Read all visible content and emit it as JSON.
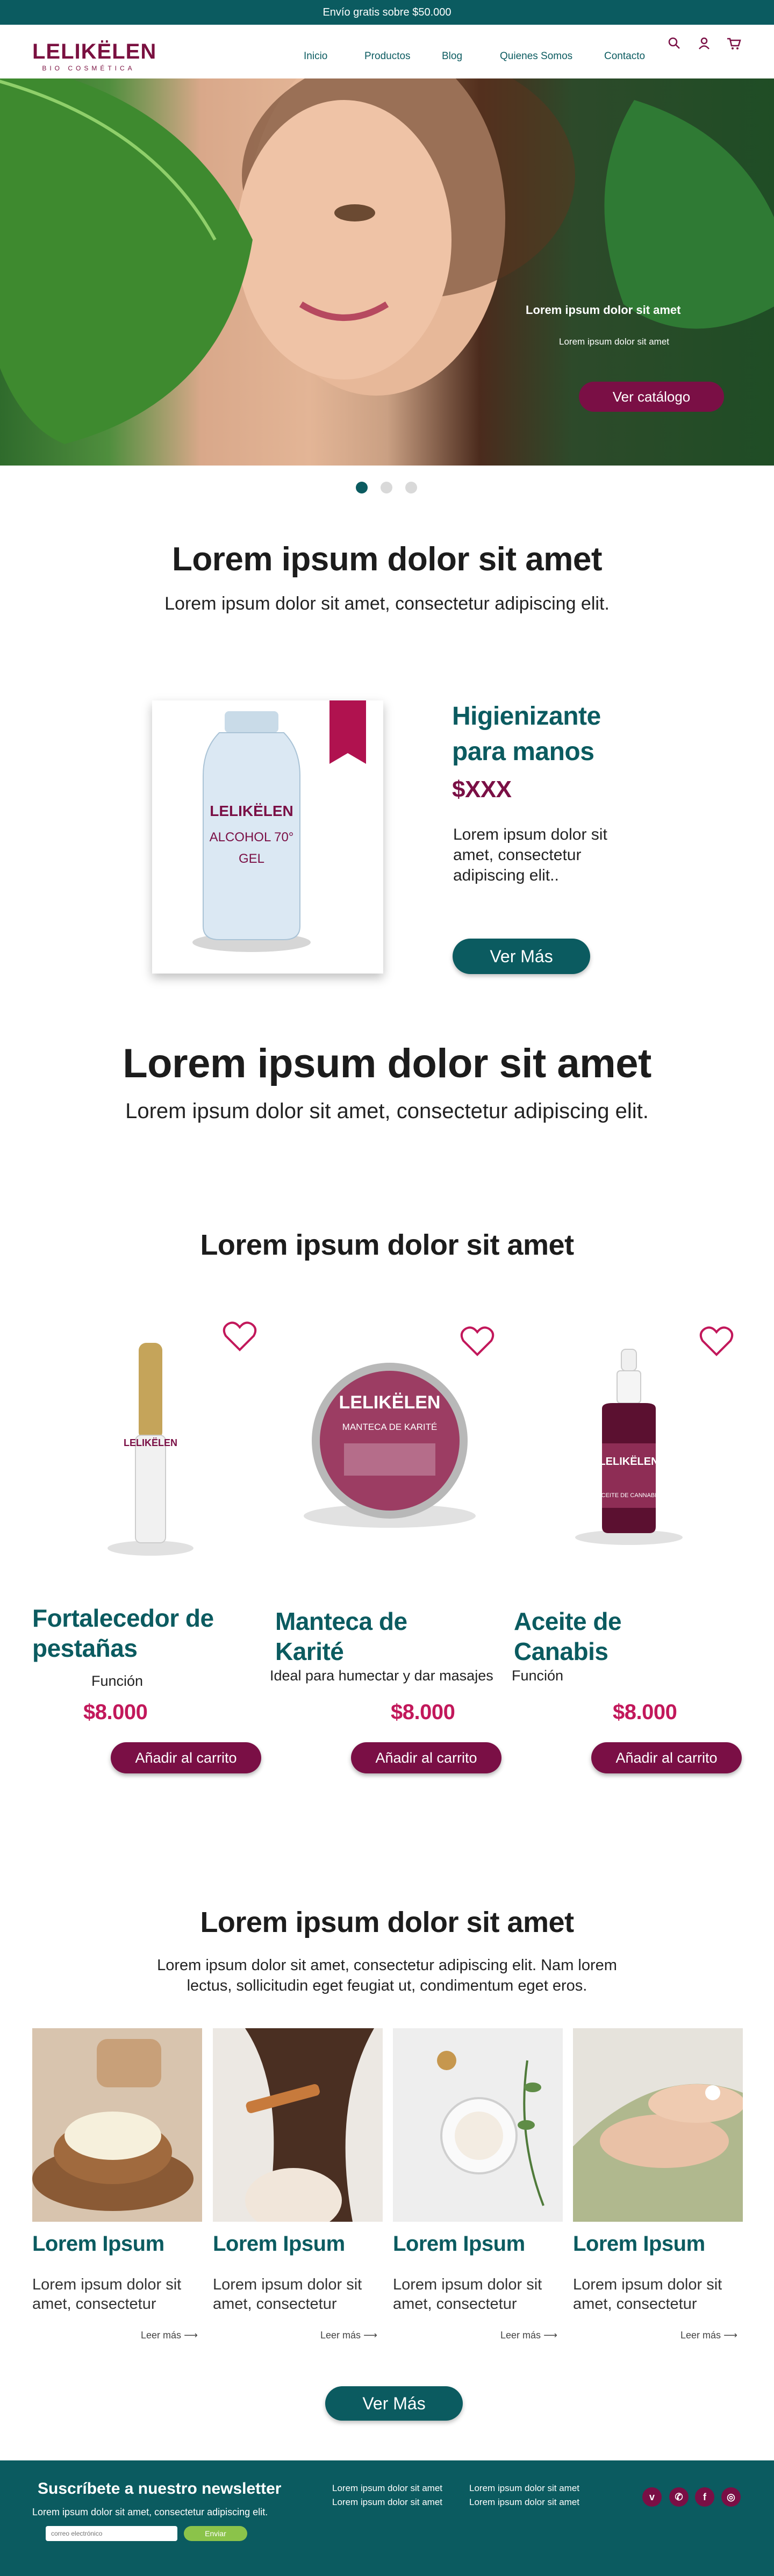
{
  "topbar": {
    "shipping": "Envío gratis sobre $50.000"
  },
  "header": {
    "logo_word": "LELIKËLEN",
    "logo_sub": "BIO COSMÉTICA",
    "nav": [
      "Inicio",
      "Productos",
      "Blog",
      "Quienes Somos",
      "Contacto"
    ],
    "icons": [
      "search-icon",
      "user-icon",
      "cart-icon"
    ]
  },
  "hero": {
    "title": "Lorem ipsum dolor sit amet",
    "subtitle": "Lorem ipsum dolor sit amet",
    "button": "Ver catálogo",
    "slides": 3,
    "active_slide": 1
  },
  "intro": {
    "title": "Lorem ipsum dolor sit amet",
    "text": "Lorem ipsum dolor sit amet, consectetur adipiscing elit."
  },
  "featured": {
    "label_brand": "LELIKËLEN",
    "label_line1": "ALCOHOL 70°",
    "label_line2": "GEL",
    "title": "Higienizante para manos",
    "price": "$XXX",
    "description": "Lorem ipsum dolor sit amet, consectetur adipiscing elit..",
    "button": "Ver Más"
  },
  "section2": {
    "title": "Lorem ipsum dolor sit amet",
    "text": "Lorem ipsum dolor sit amet, consectetur adipiscing elit."
  },
  "products": {
    "title": "Lorem ipsum dolor sit amet",
    "items": [
      {
        "name": "Fortalecedor de pestañas",
        "desc": "Función",
        "price": "$8.000",
        "button": "Añadir al carrito",
        "label": "LELIKËLEN"
      },
      {
        "name": "Manteca de Karité",
        "desc": "Ideal para humectar y dar masajes",
        "price": "$8.000",
        "button": "Añadir al carrito",
        "label": "LELIKËLEN",
        "label_sub": "MANTECA DE KARITÉ"
      },
      {
        "name": "Aceite de Canabis",
        "desc": "Función",
        "price": "$8.000",
        "button": "Añadir al carrito",
        "label": "LELIKËLEN",
        "label_sub": "ACEITE DE CANNABIS"
      }
    ]
  },
  "blog": {
    "title": "Lorem ipsum dolor sit amet",
    "text": "Lorem ipsum dolor sit amet, consectetur adipiscing elit. Nam lorem lectus, sollicitudin eget feugiat ut, condimentum eget eros.",
    "posts": [
      {
        "title": "Lorem Ipsum",
        "desc": "Lorem ipsum dolor sit amet, consectetur",
        "more": "Leer más"
      },
      {
        "title": "Lorem Ipsum",
        "desc": "Lorem ipsum dolor sit amet, consectetur",
        "more": "Leer más"
      },
      {
        "title": "Lorem Ipsum",
        "desc": "Lorem ipsum dolor sit amet, consectetur",
        "more": "Leer más"
      },
      {
        "title": "Lorem Ipsum",
        "desc": "Lorem ipsum dolor sit amet, consectetur",
        "more": "Leer más"
      }
    ],
    "button": "Ver Más"
  },
  "footer": {
    "newsletter_title": "Suscríbete a nuestro newsletter",
    "newsletter_sub": "Lorem ipsum dolor sit amet, consectetur adipiscing elit.",
    "email_placeholder": "correo electrónico",
    "send": "Enviar",
    "links": [
      "Lorem ipsum dolor sit amet",
      "Lorem ipsum dolor sit amet",
      "Lorem ipsum dolor sit amet",
      "Lorem ipsum dolor sit amet"
    ],
    "social": [
      "vimeo-icon",
      "whatsapp-icon",
      "facebook-icon",
      "instagram-icon"
    ]
  },
  "colors": {
    "teal": "#0b5b60",
    "wine": "#7a0f45",
    "pink": "#c2185b",
    "green": "#8bc34a"
  }
}
